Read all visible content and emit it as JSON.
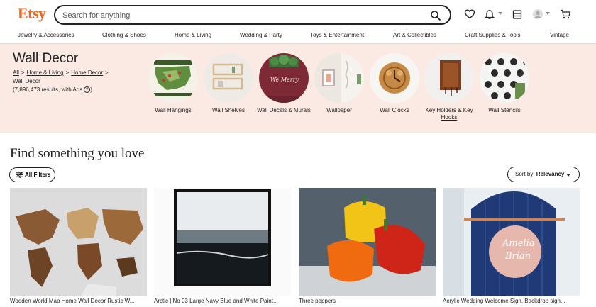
{
  "header": {
    "logo": "Etsy",
    "search_placeholder": "Search for anything"
  },
  "nav": {
    "items": [
      "Jewelry & Accessories",
      "Clothing & Shoes",
      "Home & Living",
      "Wedding & Party",
      "Toys & Entertainment",
      "Art & Collectibles",
      "Craft Supplies & Tools",
      "Vintage"
    ]
  },
  "banner": {
    "title": "Wall Decor",
    "breadcrumbs": [
      "All",
      "Home & Living",
      "Home Decor"
    ],
    "current": "Wall Decor",
    "results": "(7,896,473 results, with Ads",
    "results_close": ")",
    "help_icon": "?",
    "categories": [
      {
        "label": "Wall Hangings"
      },
      {
        "label": "Wall Shelves"
      },
      {
        "label": "Wall Decals & Murals"
      },
      {
        "label": "Wallpaper"
      },
      {
        "label": "Wall Clocks"
      },
      {
        "label": "Key Holders & Key Hooks"
      },
      {
        "label": "Wall Stencils"
      }
    ]
  },
  "main": {
    "heading": "Find something you love",
    "filters_label": "All Filters",
    "sort_prefix": "Sort by: ",
    "sort_value": "Relevancy"
  },
  "listings": [
    {
      "title": "Wooden World Map Home Wall Decor Rustic W..."
    },
    {
      "title": "Arctic | No 03 Large Navy Blue and White Paint..."
    },
    {
      "title": "Three peppers"
    },
    {
      "title": "Acrylic Wedding Welcome Sign, Backdrop sign..."
    }
  ],
  "colors": {
    "brand": "#f1641e",
    "banner_bg": "#fbe9e3"
  }
}
